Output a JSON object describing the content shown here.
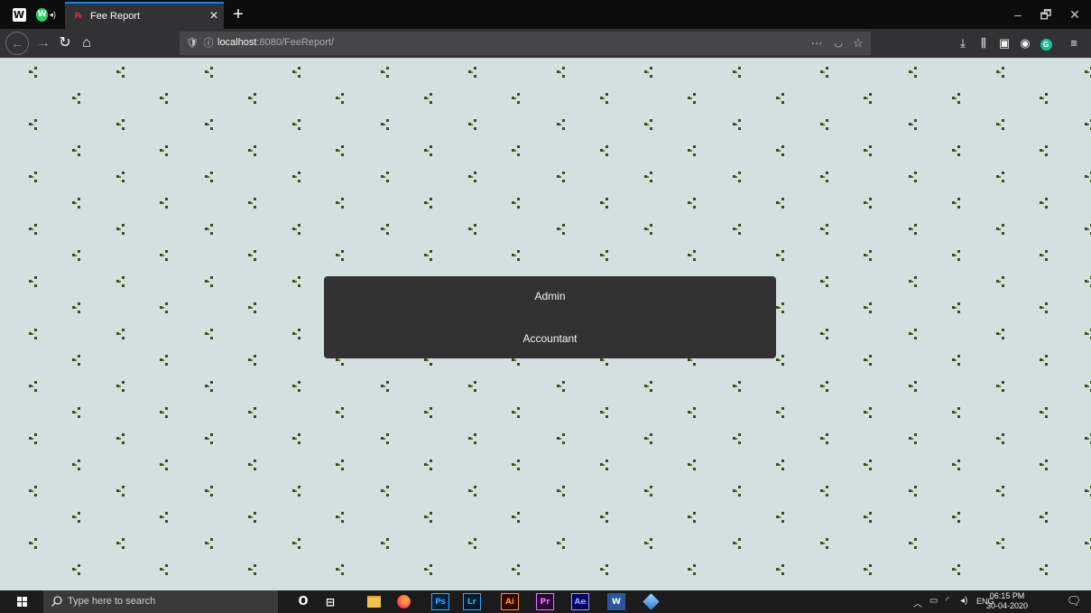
{
  "browser": {
    "tab": {
      "title": "Fee Report"
    },
    "pinned_tabs": [
      "W",
      "W"
    ],
    "address": {
      "host": "localhost",
      "rest": ":8080/FeeReport/"
    },
    "url_actions": [
      "···",
      "pocket-icon",
      "bookmark-star-icon"
    ],
    "toolbar": [
      "download-icon",
      "library-icon",
      "sidebar-icon",
      "account-icon",
      "grammarly-icon",
      "menu-icon"
    ],
    "window_controls": [
      "–",
      "🗗",
      "✕"
    ]
  },
  "page": {
    "background_color": "#d2e1df",
    "menu": {
      "items": [
        "Admin",
        "Accountant"
      ]
    }
  },
  "taskbar": {
    "search_placeholder": "Type here to search",
    "apps": {
      "cortana": "O",
      "task_view": "⊟",
      "ps": "Ps",
      "lr": "Lr",
      "ai": "Ai",
      "pr": "Pr",
      "ae": "Ae",
      "word": "W"
    },
    "tray": {
      "language": "ENG"
    },
    "clock": {
      "time": "06:15 PM",
      "date": "30-04-2020"
    }
  }
}
